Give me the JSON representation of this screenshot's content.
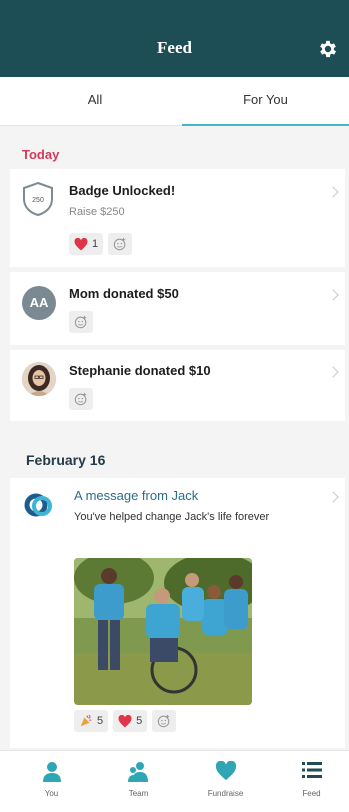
{
  "header": {
    "title": "Feed",
    "settings_icon": "gear-icon"
  },
  "tabs": [
    {
      "label": "All",
      "active": false
    },
    {
      "label": "For You",
      "active": true
    }
  ],
  "sections": {
    "today": "Today",
    "february": "February 16"
  },
  "feed": {
    "badge": {
      "title": "Badge Unlocked!",
      "subtitle": "Raise $250",
      "badge_text": "250",
      "heart_count": "1"
    },
    "mom": {
      "avatar_initials": "AA",
      "title": "Mom donated $50"
    },
    "stephanie": {
      "title": "Stephanie donated $10"
    },
    "message": {
      "title": "A message from Jack",
      "subtitle": "You've helped change Jack's life forever",
      "celebrate_count": "5",
      "heart_count": "5"
    }
  },
  "nav": [
    {
      "label": "You",
      "icon": "person-icon"
    },
    {
      "label": "Team",
      "icon": "team-icon"
    },
    {
      "label": "Fundraise",
      "icon": "heart-icon"
    },
    {
      "label": "Feed",
      "icon": "list-icon"
    }
  ],
  "colors": {
    "header_bg": "#1d4e55",
    "accent": "#40b8c8",
    "today_label": "#d33a5c",
    "heart": "#e0344a"
  }
}
